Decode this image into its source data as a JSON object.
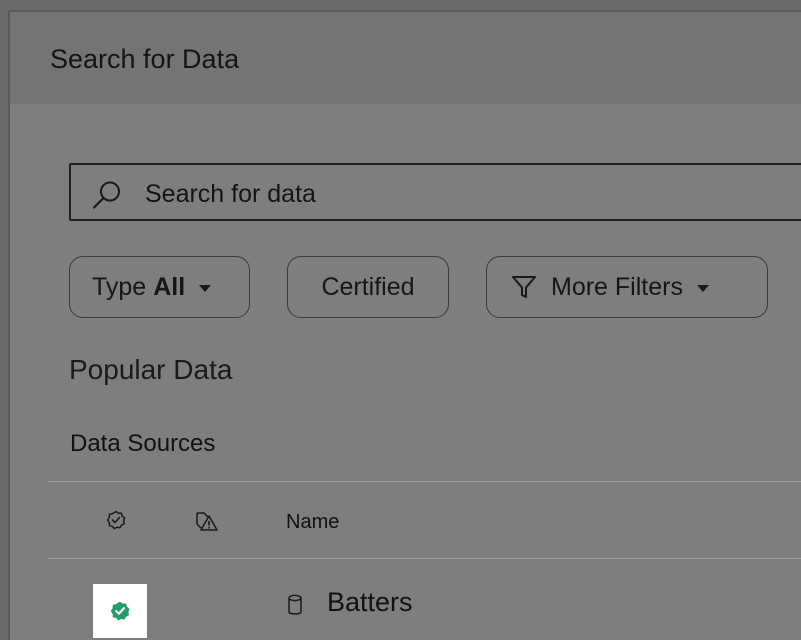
{
  "dialog": {
    "title": "Search for Data"
  },
  "search": {
    "placeholder": "Search for data",
    "icon": "search-icon"
  },
  "filters": {
    "type_prefix": "Type",
    "type_value": "All",
    "certified_label": "Certified",
    "more_filters_label": "More Filters"
  },
  "popular": {
    "title": "Popular Data",
    "subheading": "Data Sources"
  },
  "table": {
    "columns": {
      "certified_icon": "certified-icon",
      "warning_icon": "data-quality-warning-icon",
      "name": "Name"
    },
    "rows": [
      {
        "name": "Batters",
        "certified": true,
        "type_icon": "database-icon"
      }
    ]
  },
  "colors": {
    "certified_green": "#1e9e6a",
    "overlay": "#7e7e7e"
  }
}
